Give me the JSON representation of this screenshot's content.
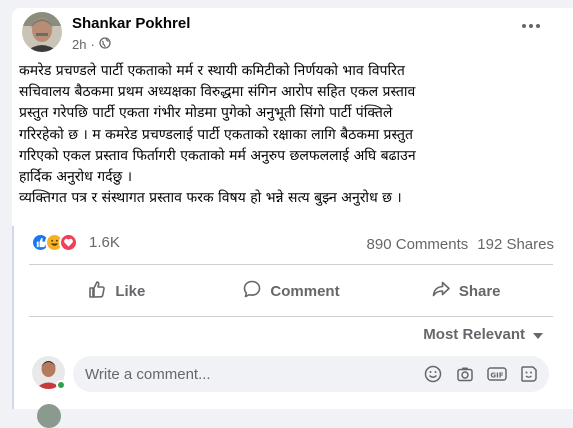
{
  "post": {
    "author": "Shankar Pokhrel",
    "time": "2h",
    "privacy_icon": "globe-icon",
    "body_lines": [
      "कमरेड प्रचण्डले पार्टी एकताको मर्म र स्थायी कमिटीको निर्णयको भाव विपरित",
      "सचिवालय बैठकमा प्रथम अध्यक्षका विरुद्धमा संगिन आरोप सहित एकल प्रस्ताव",
      "प्रस्तुत गरेपछि पार्टी एकता गंभीर मोडमा पुगेको अनुभूती सिंगो पार्टी पंक्तिले",
      "गरिरहेको छ । म कमरेड प्रचण्डलाई पार्टी एकताको रक्षाका लागि बैठकमा प्रस्तुत",
      "गरिएको एकल प्रस्ताव फिर्तागरी एकताको मर्म अनुरुप छलफललाई अघि बढाउन",
      "हार्दिक अनुरोध गर्दछु ।",
      "व्यक्तिगत पत्र र संस्थागत प्रस्ताव फरक विषय हो भन्ने सत्य बुझ्न अनुरोध छ ।"
    ]
  },
  "stats": {
    "reaction_count": "1.6K",
    "reactions": [
      "like",
      "haha",
      "love"
    ],
    "comments": "890 Comments",
    "shares": "192 Shares"
  },
  "actions": {
    "like": "Like",
    "comment": "Comment",
    "share": "Share"
  },
  "sort": {
    "label": "Most Relevant"
  },
  "composer": {
    "placeholder": "Write a comment...",
    "tools": [
      "emoji-icon",
      "camera-icon",
      "gif-icon",
      "sticker-icon"
    ]
  },
  "colors": {
    "like_blue": "#1877f2",
    "love_red": "#f33e58",
    "haha_yellow": "#f7b125",
    "online_green": "#31a24c",
    "secondary_text": "#65676b"
  }
}
